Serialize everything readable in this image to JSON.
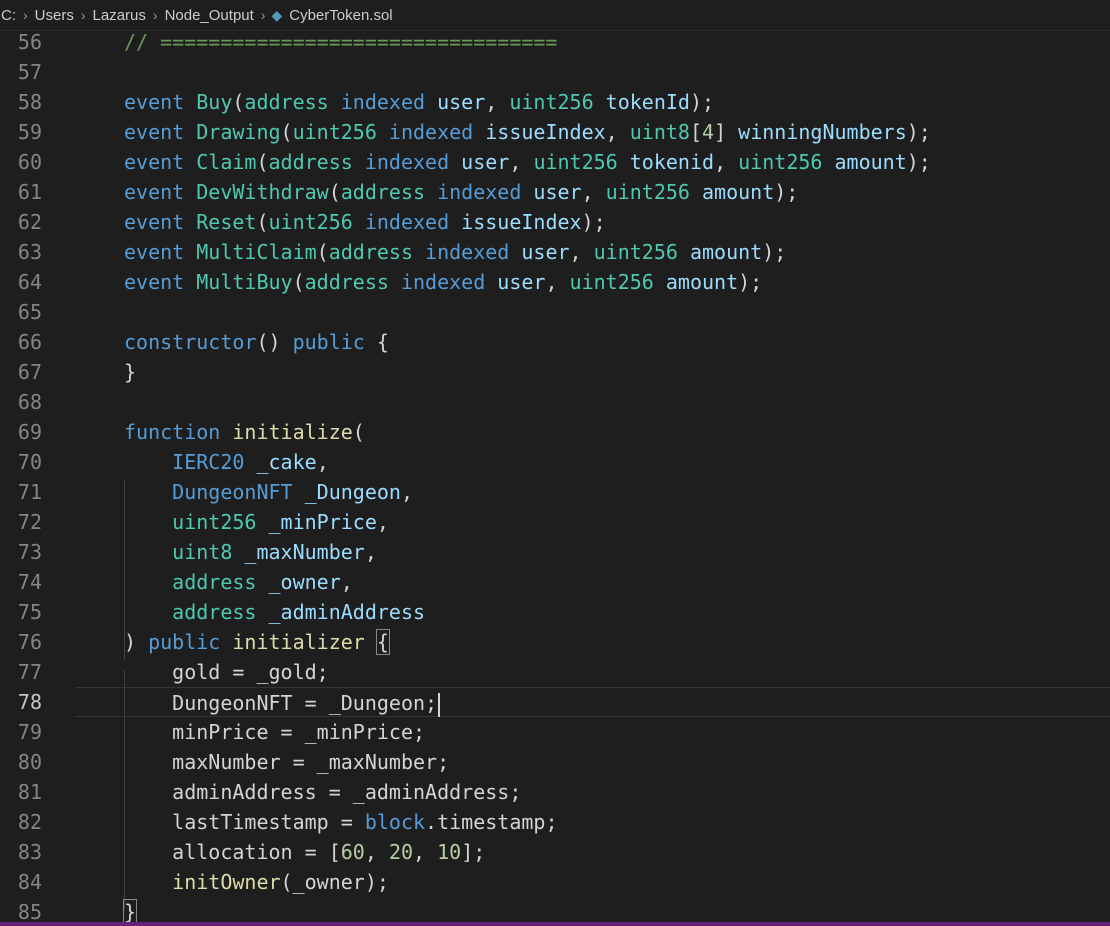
{
  "breadcrumb": {
    "segments": [
      "C:",
      "Users",
      "Lazarus",
      "Node_Output"
    ],
    "file": "CyberToken.sol",
    "file_icon": "solidity-file-icon"
  },
  "editor": {
    "current_line": 78,
    "lines": [
      {
        "n": "56",
        "tokens": [
          [
            "com",
            "// ================================="
          ]
        ]
      },
      {
        "n": "57",
        "tokens": []
      },
      {
        "n": "58",
        "tokens": [
          [
            "kw",
            "event "
          ],
          [
            "type",
            "Buy"
          ],
          [
            "plain",
            "("
          ],
          [
            "type",
            "address "
          ],
          [
            "kw",
            "indexed "
          ],
          [
            "var",
            "user"
          ],
          [
            "plain",
            ", "
          ],
          [
            "type",
            "uint256 "
          ],
          [
            "var",
            "tokenId"
          ],
          [
            "plain",
            ");"
          ]
        ]
      },
      {
        "n": "59",
        "tokens": [
          [
            "kw",
            "event "
          ],
          [
            "type",
            "Drawing"
          ],
          [
            "plain",
            "("
          ],
          [
            "type",
            "uint256 "
          ],
          [
            "kw",
            "indexed "
          ],
          [
            "var",
            "issueIndex"
          ],
          [
            "plain",
            ", "
          ],
          [
            "type",
            "uint8"
          ],
          [
            "plain",
            "["
          ],
          [
            "num",
            "4"
          ],
          [
            "plain",
            "] "
          ],
          [
            "var",
            "winningNumbers"
          ],
          [
            "plain",
            ");"
          ]
        ]
      },
      {
        "n": "60",
        "tokens": [
          [
            "kw",
            "event "
          ],
          [
            "type",
            "Claim"
          ],
          [
            "plain",
            "("
          ],
          [
            "type",
            "address "
          ],
          [
            "kw",
            "indexed "
          ],
          [
            "var",
            "user"
          ],
          [
            "plain",
            ", "
          ],
          [
            "type",
            "uint256 "
          ],
          [
            "var",
            "tokenid"
          ],
          [
            "plain",
            ", "
          ],
          [
            "type",
            "uint256 "
          ],
          [
            "var",
            "amount"
          ],
          [
            "plain",
            ");"
          ]
        ]
      },
      {
        "n": "61",
        "tokens": [
          [
            "kw",
            "event "
          ],
          [
            "type",
            "DevWithdraw"
          ],
          [
            "plain",
            "("
          ],
          [
            "type",
            "address "
          ],
          [
            "kw",
            "indexed "
          ],
          [
            "var",
            "user"
          ],
          [
            "plain",
            ", "
          ],
          [
            "type",
            "uint256 "
          ],
          [
            "var",
            "amount"
          ],
          [
            "plain",
            ");"
          ]
        ]
      },
      {
        "n": "62",
        "tokens": [
          [
            "kw",
            "event "
          ],
          [
            "type",
            "Reset"
          ],
          [
            "plain",
            "("
          ],
          [
            "type",
            "uint256 "
          ],
          [
            "kw",
            "indexed "
          ],
          [
            "var",
            "issueIndex"
          ],
          [
            "plain",
            ");"
          ]
        ]
      },
      {
        "n": "63",
        "tokens": [
          [
            "kw",
            "event "
          ],
          [
            "type",
            "MultiClaim"
          ],
          [
            "plain",
            "("
          ],
          [
            "type",
            "address "
          ],
          [
            "kw",
            "indexed "
          ],
          [
            "var",
            "user"
          ],
          [
            "plain",
            ", "
          ],
          [
            "type",
            "uint256 "
          ],
          [
            "var",
            "amount"
          ],
          [
            "plain",
            ");"
          ]
        ]
      },
      {
        "n": "64",
        "tokens": [
          [
            "kw",
            "event "
          ],
          [
            "type",
            "MultiBuy"
          ],
          [
            "plain",
            "("
          ],
          [
            "type",
            "address "
          ],
          [
            "kw",
            "indexed "
          ],
          [
            "var",
            "user"
          ],
          [
            "plain",
            ", "
          ],
          [
            "type",
            "uint256 "
          ],
          [
            "var",
            "amount"
          ],
          [
            "plain",
            ");"
          ]
        ]
      },
      {
        "n": "65",
        "tokens": []
      },
      {
        "n": "66",
        "tokens": [
          [
            "kw",
            "constructor"
          ],
          [
            "plain",
            "() "
          ],
          [
            "kw",
            "public "
          ],
          [
            "plain",
            "{"
          ]
        ]
      },
      {
        "n": "67",
        "tokens": [
          [
            "plain",
            "}"
          ]
        ]
      },
      {
        "n": "68",
        "tokens": []
      },
      {
        "n": "69",
        "tokens": [
          [
            "kw",
            "function "
          ],
          [
            "fn",
            "initialize"
          ],
          [
            "plain",
            "("
          ]
        ]
      },
      {
        "n": "70",
        "tokens": [
          [
            "plain",
            "    "
          ],
          [
            "kw",
            "IERC20 "
          ],
          [
            "var",
            "_cake"
          ],
          [
            "plain",
            ","
          ]
        ]
      },
      {
        "n": "71",
        "tokens": [
          [
            "plain",
            "    "
          ],
          [
            "kw",
            "DungeonNFT "
          ],
          [
            "var",
            "_Dungeon"
          ],
          [
            "plain",
            ","
          ]
        ]
      },
      {
        "n": "72",
        "tokens": [
          [
            "plain",
            "    "
          ],
          [
            "type",
            "uint256 "
          ],
          [
            "var",
            "_minPrice"
          ],
          [
            "plain",
            ","
          ]
        ]
      },
      {
        "n": "73",
        "tokens": [
          [
            "plain",
            "    "
          ],
          [
            "type",
            "uint8 "
          ],
          [
            "var",
            "_maxNumber"
          ],
          [
            "plain",
            ","
          ]
        ]
      },
      {
        "n": "74",
        "tokens": [
          [
            "plain",
            "    "
          ],
          [
            "type",
            "address "
          ],
          [
            "var",
            "_owner"
          ],
          [
            "plain",
            ","
          ]
        ]
      },
      {
        "n": "75",
        "tokens": [
          [
            "plain",
            "    "
          ],
          [
            "type",
            "address "
          ],
          [
            "var",
            "_adminAddress"
          ]
        ]
      },
      {
        "n": "76",
        "tokens": [
          [
            "plain",
            ") "
          ],
          [
            "kw",
            "public "
          ],
          [
            "fn",
            "initializer "
          ],
          [
            "plain",
            "{"
          ]
        ]
      },
      {
        "n": "77",
        "tokens": [
          [
            "plain",
            "    "
          ],
          [
            "plain",
            "gold = _gold;"
          ]
        ]
      },
      {
        "n": "78",
        "tokens": [
          [
            "plain",
            "    "
          ],
          [
            "plain",
            "DungeonNFT = _Dungeon;"
          ]
        ]
      },
      {
        "n": "79",
        "tokens": [
          [
            "plain",
            "    "
          ],
          [
            "plain",
            "minPrice = _minPrice;"
          ]
        ]
      },
      {
        "n": "80",
        "tokens": [
          [
            "plain",
            "    "
          ],
          [
            "plain",
            "maxNumber = _maxNumber;"
          ]
        ]
      },
      {
        "n": "81",
        "tokens": [
          [
            "plain",
            "    "
          ],
          [
            "plain",
            "adminAddress = _adminAddress;"
          ]
        ]
      },
      {
        "n": "82",
        "tokens": [
          [
            "plain",
            "    "
          ],
          [
            "plain",
            "lastTimestamp = "
          ],
          [
            "kw",
            "block"
          ],
          [
            "plain",
            ".timestamp;"
          ]
        ]
      },
      {
        "n": "83",
        "tokens": [
          [
            "plain",
            "    "
          ],
          [
            "plain",
            "allocation = ["
          ],
          [
            "num",
            "60"
          ],
          [
            "plain",
            ", "
          ],
          [
            "num",
            "20"
          ],
          [
            "plain",
            ", "
          ],
          [
            "num",
            "10"
          ],
          [
            "plain",
            "];"
          ]
        ]
      },
      {
        "n": "84",
        "tokens": [
          [
            "plain",
            "    "
          ],
          [
            "fn",
            "initOwner"
          ],
          [
            "plain",
            "(_owner);"
          ]
        ]
      },
      {
        "n": "85",
        "tokens": [
          [
            "plain",
            "}"
          ]
        ]
      }
    ]
  },
  "colors": {
    "background": "#1e1e1e",
    "keyword": "#569cd6",
    "type": "#4ec9b0",
    "variable": "#9cdcfe",
    "function": "#dcdcaa",
    "number": "#b5cea8",
    "comment": "#6a9955",
    "text": "#d4d4d4",
    "status_bar": "#68217a"
  }
}
